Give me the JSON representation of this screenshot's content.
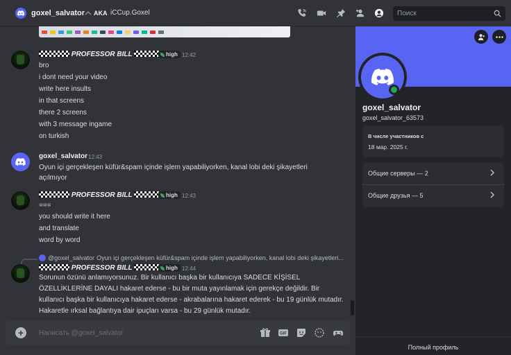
{
  "header": {
    "username": "goxel_salvator",
    "aka_label": "AKA",
    "aka_name": "iCCup.Goxel",
    "search_placeholder": "Поиск"
  },
  "messages": [
    {
      "author": "PROFESSOR BILL",
      "badge": "high",
      "time": "12:42",
      "lines": [
        "bro",
        "i dont need your video",
        "write here insults",
        "in that screens",
        "there 2 screens",
        "with 3 message ingame",
        "on turkish"
      ]
    },
    {
      "author": "goxel_salvator",
      "time": "12:43",
      "lines": [
        "Oyun içi gerçekleşen küfür&spam içinde işlem yapabiliyorken, kanal lobi deki şikayetleri",
        "açılmıyor"
      ]
    },
    {
      "author": "PROFESSOR BILL",
      "badge": "high",
      "time": "12:43",
      "lines": [
        "===",
        "you should write it here",
        "and translate",
        "word by word"
      ]
    },
    {
      "reply_author": "@goxel_salvator",
      "reply_text": "Oyun içi gerçekleşen küfür&spam içinde işlem yapabiliyorken, kanal lobi deki şikayetleri...",
      "author": "PROFESSOR BILL",
      "badge": "high",
      "time": "12:44",
      "text": "Sorunun özünü anlamıyorsunuz. Bir kullanıcı başka bir kullanıcıya SADECE KİŞİSEL ÖZELLİKLERİNE DAYALI hakaret ederse - bu bir muta yayınlamak için gerekçe değildir. Bir kullanıcı başka bir kullanıcıya hakaret ederse - akrabalarına hakaret ederek - bu 19 günlük mutadır. Hakaretle ırksal bağlantıya dair ipuçları varsa - bu 29 günlük mutadır."
    }
  ],
  "composer": {
    "placeholder": "Написать @goxel_salvator"
  },
  "profile": {
    "display_name": "goxel_salvator",
    "tag": "goxel_salvator_63573",
    "member_since_label": "В числе участников с",
    "member_since_date": "18 мар. 2025 г.",
    "mutual_servers": "Общие серверы — 2",
    "mutual_friends": "Общие друзья — 5",
    "full_profile": "Полный профиль"
  },
  "colors": {
    "blurple": "#5865f2",
    "online": "#23a55a",
    "background": "#313338",
    "panel": "#232428"
  }
}
